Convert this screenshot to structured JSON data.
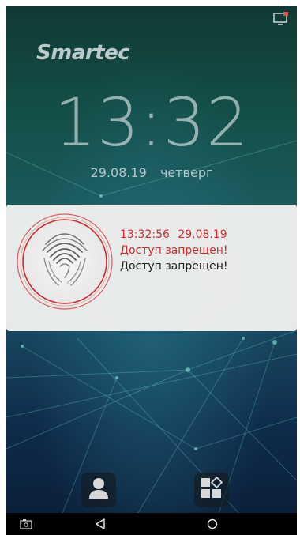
{
  "status_bar": {
    "icon": "cast-icon"
  },
  "lock_screen": {
    "logo_text": "Smartec",
    "time": "13:32",
    "date": "29.08.19",
    "weekday": "четверг"
  },
  "notification": {
    "image": "fingerprint-scan",
    "time": "13:32:56",
    "date": "29.08.19",
    "title": "Доступ запрещен!",
    "message": "Доступ запрещен!",
    "accent_color": "#d92a2a"
  },
  "bottom_buttons": [
    {
      "icon": "user-icon"
    },
    {
      "icon": "apps-icon"
    }
  ],
  "navbar": {
    "items": [
      "screenshot-icon",
      "back-icon",
      "home-icon"
    ]
  },
  "colors": {
    "background_top": "#0f3a34",
    "background_bottom": "#0a1c36",
    "notification_bg": "#eef0ee"
  }
}
